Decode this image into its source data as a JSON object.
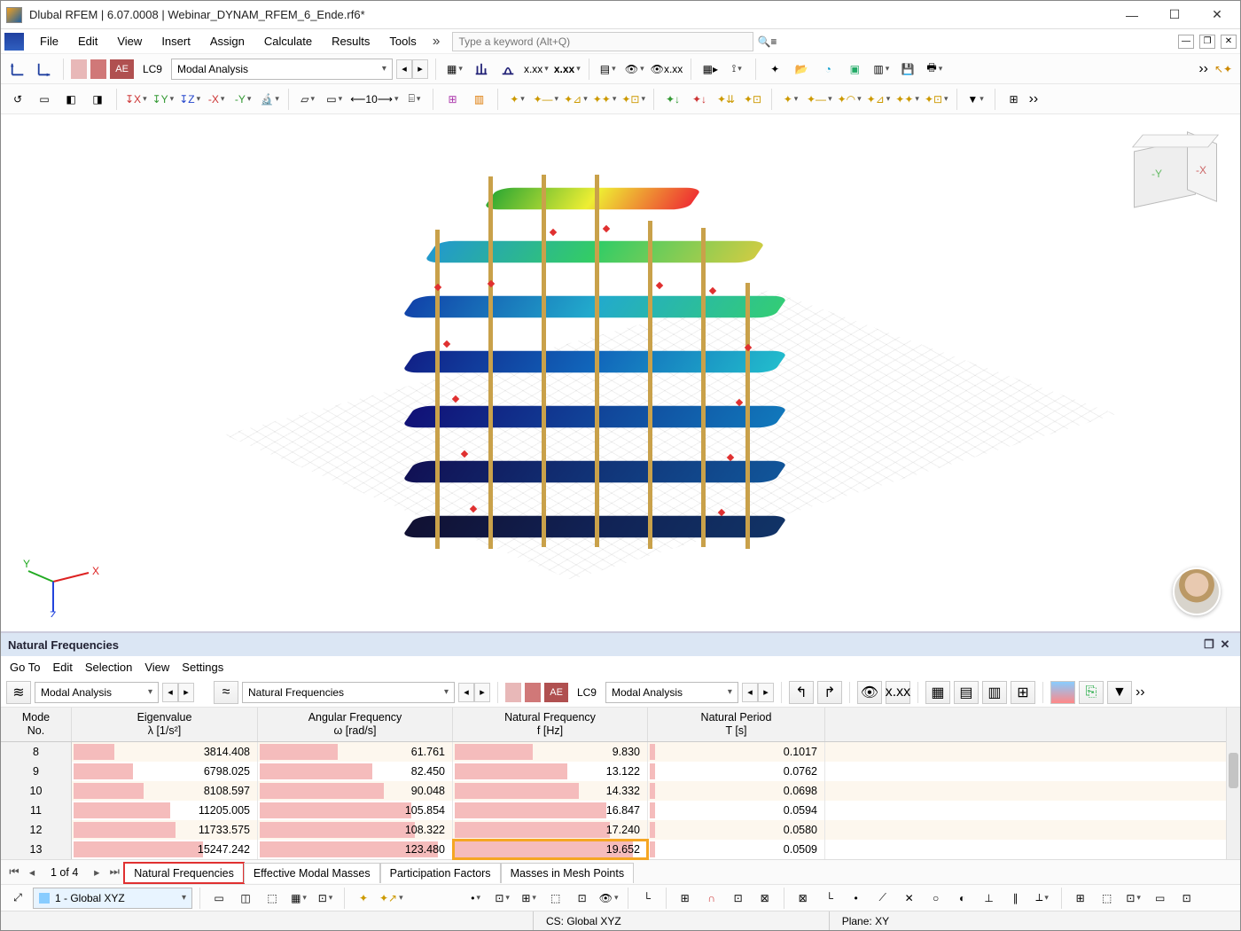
{
  "window": {
    "title": "Dlubal RFEM | 6.07.0008 | Webinar_DYNAM_RFEM_6_Ende.rf6*"
  },
  "menu": [
    "File",
    "Edit",
    "View",
    "Insert",
    "Assign",
    "Calculate",
    "Results",
    "Tools"
  ],
  "search_placeholder": "Type a keyword (Alt+Q)",
  "loadcase": {
    "lc": "LC9",
    "desc": "Modal Analysis",
    "badge": "AE"
  },
  "panel": {
    "title": "Natural Frequencies",
    "menu": [
      "Go To",
      "Edit",
      "Selection",
      "View",
      "Settings"
    ],
    "left_combo": "Modal Analysis",
    "mid_combo": "Natural Frequencies",
    "lc": "LC9",
    "lc_desc": "Modal Analysis",
    "badge": "AE"
  },
  "table": {
    "header0": "Mode",
    "header0sub": "No.",
    "header1": "Eigenvalue",
    "header1sub": "λ [1/s²]",
    "header2": "Angular Frequency",
    "header2sub": "ω [rad/s]",
    "header3": "Natural Frequency",
    "header3sub": "f [Hz]",
    "header4": "Natural Period",
    "header4sub": "T [s]",
    "rows": [
      {
        "no": "8",
        "eig": "3814.408",
        "ang": "61.761",
        "freq": "9.830",
        "per": "0.1017",
        "w1": 22,
        "w2": 40,
        "w3": 40,
        "w4": 3
      },
      {
        "no": "9",
        "eig": "6798.025",
        "ang": "82.450",
        "freq": "13.122",
        "per": "0.0762",
        "w1": 32,
        "w2": 58,
        "w3": 58,
        "w4": 3
      },
      {
        "no": "10",
        "eig": "8108.597",
        "ang": "90.048",
        "freq": "14.332",
        "per": "0.0698",
        "w1": 38,
        "w2": 64,
        "w3": 64,
        "w4": 3
      },
      {
        "no": "11",
        "eig": "11205.005",
        "ang": "105.854",
        "freq": "16.847",
        "per": "0.0594",
        "w1": 52,
        "w2": 78,
        "w3": 78,
        "w4": 3
      },
      {
        "no": "12",
        "eig": "11733.575",
        "ang": "108.322",
        "freq": "17.240",
        "per": "0.0580",
        "w1": 55,
        "w2": 80,
        "w3": 80,
        "w4": 3
      },
      {
        "no": "13",
        "eig": "15247.242",
        "ang": "123.480",
        "freq": "19.652",
        "per": "0.0509",
        "w1": 70,
        "w2": 92,
        "w3": 92,
        "w4": 3
      }
    ],
    "highlight_row_col": [
      5,
      3
    ]
  },
  "sheets": {
    "page": "1 of 4",
    "tabs": [
      "Natural Frequencies",
      "Effective Modal Masses",
      "Participation Factors",
      "Masses in Mesh Points"
    ],
    "active": 0
  },
  "bottom_combo": "1 - Global XYZ",
  "status": {
    "cs": "CS: Global XYZ",
    "plane": "Plane: XY"
  }
}
